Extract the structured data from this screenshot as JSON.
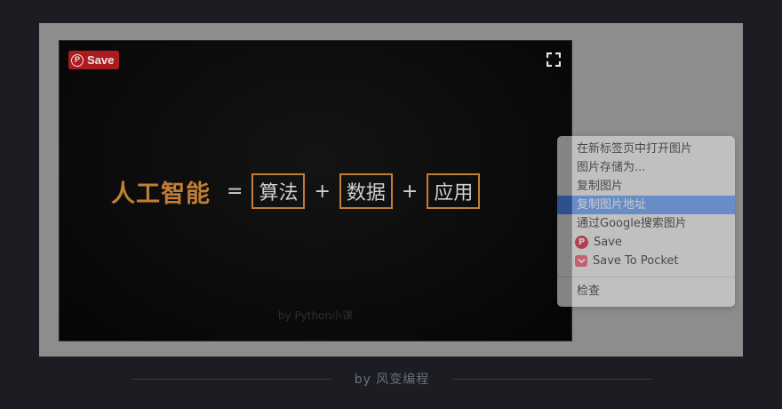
{
  "image": {
    "pin_save_label": "Save",
    "pin_icon": "pinterest-icon",
    "expand_icon": "expand-icon",
    "formula": {
      "title": "人工智能",
      "equals": "=",
      "terms": [
        "算法",
        "数据",
        "应用"
      ],
      "plus": "+"
    },
    "watermark": "by Python小课"
  },
  "context_menu": {
    "items": [
      "在新标签页中打开图片",
      "图片存储为...",
      "复制图片",
      "复制图片地址",
      "通过Google搜索图片",
      "Save",
      "Save To Pocket",
      "检查"
    ],
    "highlighted_index": 3,
    "highlight_color": "#4a8cf7"
  },
  "caption": "by 风变编程",
  "colors": {
    "background": "#1c1d23",
    "accent_orange": "#c27e35",
    "pinterest_red": "#bd1e22",
    "pocket_red": "#ef4056"
  }
}
